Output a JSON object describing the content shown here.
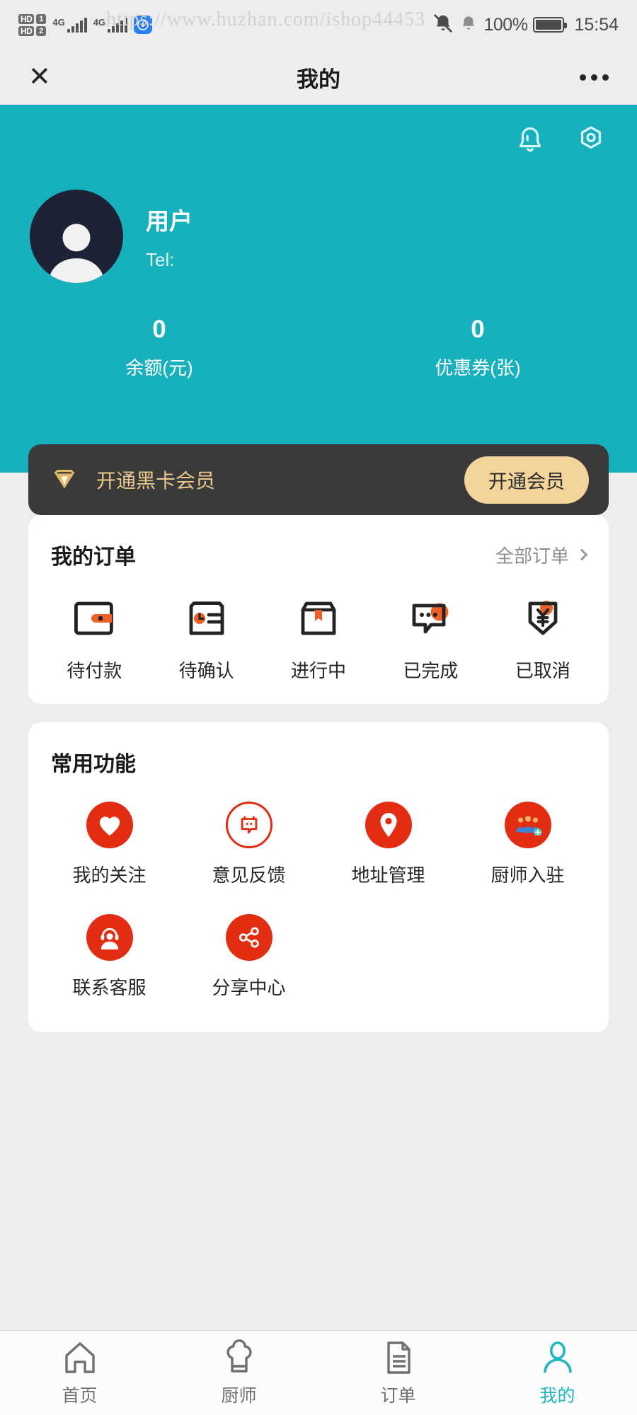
{
  "status_bar": {
    "hd1_label": "HD",
    "hd1_num": "1",
    "hd2_label": "HD",
    "hd2_num": "2",
    "net1": "4G",
    "net2": "4G",
    "app_badge_icon": "download-app-icon",
    "battery_percent": "100%",
    "time": "15:54",
    "alarm_muted_icon": "alarm-muted-icon",
    "bell_icon": "bell-icon",
    "watermark": "https://www.huzhan.com/ishop44453"
  },
  "navbar": {
    "close_icon": "close-icon",
    "title": "我的",
    "more_icon": "more-icon"
  },
  "header": {
    "bell_icon": "bell-icon",
    "settings_icon": "settings-hex-icon",
    "avatar_icon": "avatar-icon",
    "user_name": "用户",
    "tel_label": "Tel:",
    "stats": [
      {
        "value": "0",
        "label": "余额(元)"
      },
      {
        "value": "0",
        "label": "优惠券(张)"
      }
    ]
  },
  "black_card": {
    "gem_icon": "gem-icon",
    "text": "开通黑卡会员",
    "button_label": "开通会员"
  },
  "orders_card": {
    "title": "我的订单",
    "link_label": "全部订单",
    "chevron_icon": "chevron-right-icon",
    "items": [
      {
        "label": "待付款",
        "icon": "wallet-icon"
      },
      {
        "label": "待确认",
        "icon": "clock-card-icon"
      },
      {
        "label": "进行中",
        "icon": "box-icon"
      },
      {
        "label": "已完成",
        "icon": "chat-bubble-icon"
      },
      {
        "label": "已取消",
        "icon": "yuan-shield-icon"
      }
    ]
  },
  "functions_card": {
    "title": "常用功能",
    "items": [
      {
        "label": "我的关注",
        "icon": "heart-icon"
      },
      {
        "label": "意见反馈",
        "icon": "feedback-chat-icon"
      },
      {
        "label": "地址管理",
        "icon": "location-pin-icon"
      },
      {
        "label": "厨师入驻",
        "icon": "chef-join-icon"
      },
      {
        "label": "联系客服",
        "icon": "headset-support-icon"
      },
      {
        "label": "分享中心",
        "icon": "share-icon"
      }
    ]
  },
  "tabbar": {
    "items": [
      {
        "label": "首页",
        "icon": "home-icon",
        "active": false
      },
      {
        "label": "厨师",
        "icon": "chef-hat-icon",
        "active": false
      },
      {
        "label": "订单",
        "icon": "document-icon",
        "active": false
      },
      {
        "label": "我的",
        "icon": "person-icon",
        "active": true
      }
    ]
  },
  "colors": {
    "teal": "#17b0bd",
    "accent_red": "#e22d13",
    "gold": "#f3d59b",
    "orange": "#ef6026",
    "dark": "#1e2235",
    "page_bg": "#ededed"
  }
}
